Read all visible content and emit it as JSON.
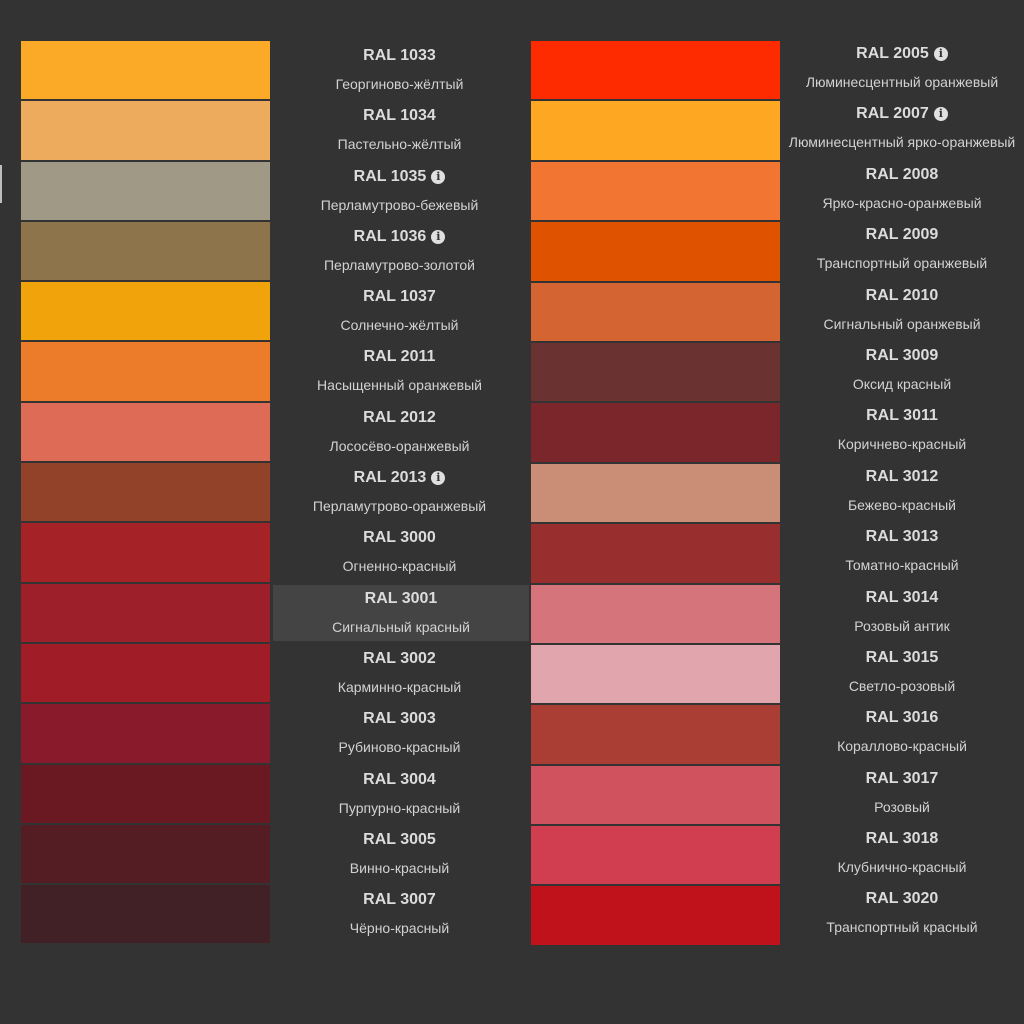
{
  "left_column": [
    {
      "code": "RAL 1033",
      "name": "Георгиново-жёлтый",
      "color": "#FBAA27",
      "info": false
    },
    {
      "code": "RAL 1034",
      "name": "Пастельно-жёлтый",
      "color": "#EDAB5E",
      "info": false
    },
    {
      "code": "RAL 1035",
      "name": "Перламутрово-бежевый",
      "color": "#9F9986",
      "info": true
    },
    {
      "code": "RAL 1036",
      "name": "Перламутрово-золотой",
      "color": "#8D744B",
      "info": true
    },
    {
      "code": "RAL 1037",
      "name": "Солнечно-жёлтый",
      "color": "#F0A30A",
      "info": false
    },
    {
      "code": "RAL 2011",
      "name": "Насыщенный оранжевый",
      "color": "#EC7B2A",
      "info": false
    },
    {
      "code": "RAL 2012",
      "name": "Лососёво-оранжевый",
      "color": "#DE6B55",
      "info": false
    },
    {
      "code": "RAL 2013",
      "name": "Перламутрово-оранжевый",
      "color": "#924228",
      "info": true
    },
    {
      "code": "RAL 3000",
      "name": "Огненно-красный",
      "color": "#A52227",
      "info": false
    },
    {
      "code": "RAL 3001",
      "name": "Сигнальный красный",
      "color": "#9D1F29",
      "info": false,
      "highlight": true
    },
    {
      "code": "RAL 3002",
      "name": "Карминно-красный",
      "color": "#A01D28",
      "info": false
    },
    {
      "code": "RAL 3003",
      "name": "Рубиново-красный",
      "color": "#881A2B",
      "info": false
    },
    {
      "code": "RAL 3004",
      "name": "Пурпурно-красный",
      "color": "#6A1923",
      "info": false
    },
    {
      "code": "RAL 3005",
      "name": "Винно-красный",
      "color": "#541D24",
      "info": false
    },
    {
      "code": "RAL 3007",
      "name": "Чёрно-красный",
      "color": "#412125",
      "info": false
    }
  ],
  "right_column": [
    {
      "code": "RAL 2005",
      "name": "Люминесцентный оранжевый",
      "color": "#FE2A00",
      "info": true
    },
    {
      "code": "RAL 2007",
      "name": "Люминесцентный ярко-оранжевый",
      "color": "#FEA723",
      "info": true
    },
    {
      "code": "RAL 2008",
      "name": "Ярко-красно-оранжевый",
      "color": "#F27532",
      "info": false
    },
    {
      "code": "RAL 2009",
      "name": "Транспортный оранжевый",
      "color": "#DF5200",
      "info": false
    },
    {
      "code": "RAL 2010",
      "name": "Сигнальный оранжевый",
      "color": "#D46532",
      "info": false
    },
    {
      "code": "RAL 3009",
      "name": "Оксид красный",
      "color": "#6A3331",
      "info": false
    },
    {
      "code": "RAL 3011",
      "name": "Коричнево-красный",
      "color": "#7B262B",
      "info": false
    },
    {
      "code": "RAL 3012",
      "name": "Бежево-красный",
      "color": "#CA8E77",
      "info": false
    },
    {
      "code": "RAL 3013",
      "name": "Томатно-красный",
      "color": "#992E2F",
      "info": false
    },
    {
      "code": "RAL 3014",
      "name": "Розовый антик",
      "color": "#D6747C",
      "info": false
    },
    {
      "code": "RAL 3015",
      "name": "Светло-розовый",
      "color": "#E1A6AD",
      "info": false
    },
    {
      "code": "RAL 3016",
      "name": "Кораллово-красный",
      "color": "#AA3E35",
      "info": false
    },
    {
      "code": "RAL 3017",
      "name": "Розовый",
      "color": "#D1525F",
      "info": false
    },
    {
      "code": "RAL 3018",
      "name": "Клубнично-красный",
      "color": "#D03E50",
      "info": false
    },
    {
      "code": "RAL 3020",
      "name": "Транспортный красный",
      "color": "#C0121B",
      "info": false
    }
  ]
}
